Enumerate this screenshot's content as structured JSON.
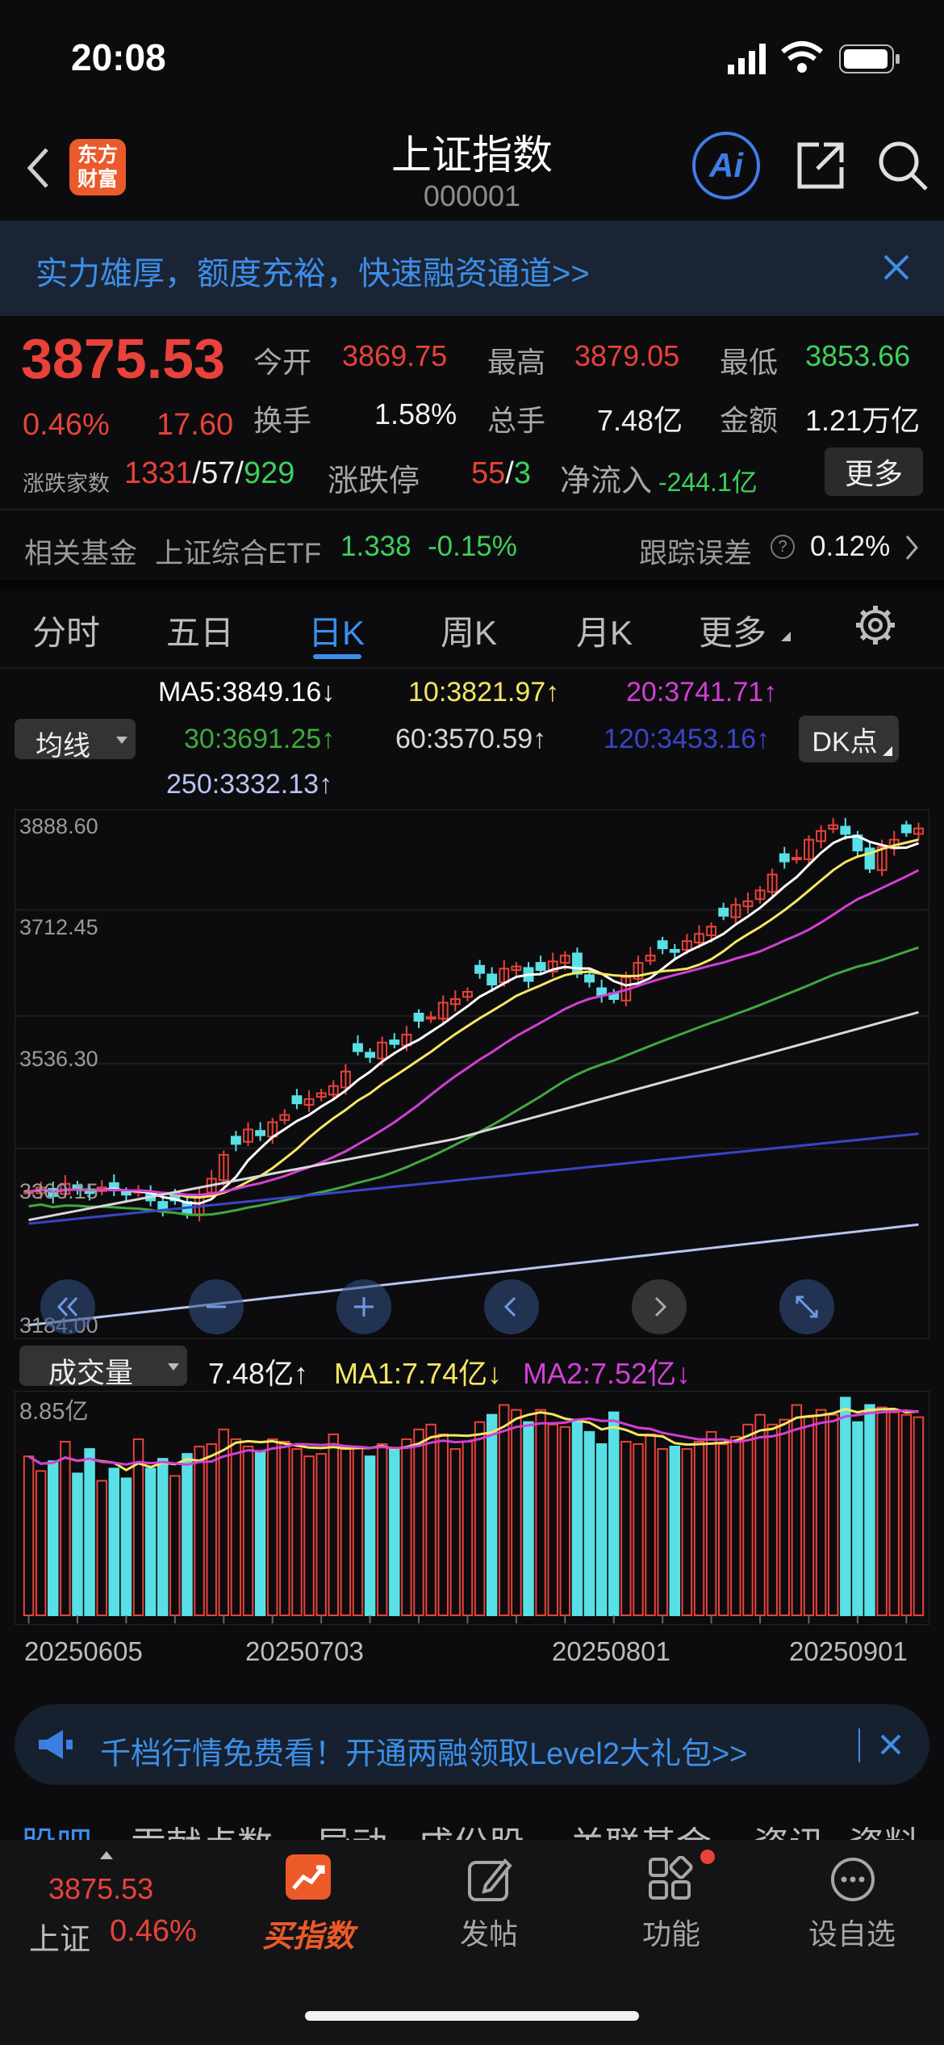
{
  "status_bar": {
    "time": "20:08"
  },
  "header": {
    "title": "上证指数",
    "code": "000001",
    "logo_line1": "东方",
    "logo_line2": "财富",
    "ai_label": "Ai"
  },
  "banner": {
    "text": "实力雄厚，额度充裕，快速融资通道>>"
  },
  "quote": {
    "price": "3875.53",
    "change_pct": "0.46%",
    "change": "17.60",
    "open_label": "今开",
    "open": "3869.75",
    "high_label": "最高",
    "high": "3879.05",
    "low_label": "最低",
    "low": "3853.66",
    "turnover_label": "换手",
    "turnover": "1.58%",
    "volume_label": "总手",
    "volume": "7.48亿",
    "amount_label": "金额",
    "amount": "1.21万亿",
    "breadth_label": "涨跌家数",
    "up_count": "1331",
    "sep1": "/",
    "flat_count": "57",
    "sep2": "/",
    "down_count": "929",
    "limit_label": "涨跌停",
    "limit_up": "55",
    "sep3": "/",
    "limit_down": "3",
    "netflow_label": "净流入",
    "netflow": "-244.1亿",
    "more_button": "更多"
  },
  "fund": {
    "label": "相关基金",
    "name": "上证综合ETF",
    "price": "1.338",
    "change": "-0.15%",
    "track_label": "跟踪误差",
    "track_value": "0.12%",
    "help": "?"
  },
  "tabs": [
    "分时",
    "五日",
    "日K",
    "周K",
    "月K",
    "更多"
  ],
  "active_tab": "日K",
  "ma": {
    "selector": "均线",
    "ma5": "MA5:3849.16↓",
    "ma10": "10:3821.97↑",
    "ma20": "20:3741.71↑",
    "ma30": "30:3691.25↑",
    "ma60": "60:3570.59↑",
    "ma120": "120:3453.16↑",
    "ma250": "250:3332.13↑",
    "dk_button": "DK点",
    "colors": {
      "ma5": "#ffffff",
      "ma10": "#f5e663",
      "ma20": "#d43fd6",
      "ma30": "#3fa83f",
      "ma60": "#d8d8d8",
      "ma120": "#3a44c8",
      "ma250": "#b9c4f2"
    }
  },
  "kline_axis": {
    "y_labels": [
      "3888.60",
      "3712.45",
      "3536.30",
      "3360.15",
      "3184.00"
    ],
    "ylim": [
      3184.0,
      3888.6
    ]
  },
  "volume_panel": {
    "selector": "成交量",
    "vol": "7.48亿↑",
    "ma1": "MA1:7.74亿↓",
    "ma2": "MA2:7.52亿↓",
    "max_label": "8.85亿",
    "x_labels": [
      "20250605",
      "20250703",
      "20250801",
      "20250901"
    ]
  },
  "promo": {
    "text": "千档行情免费看！开通两融领取Level2大礼包>>"
  },
  "bottom_tabs_partial": [
    "股吧",
    "贡献点数",
    "异动",
    "成份股",
    "关联基金",
    "资讯",
    "资料"
  ],
  "bottom_nav": {
    "index_price": "3875.53",
    "index_name": "上证",
    "index_pct": "0.46%",
    "buy": "买指数",
    "post": "发帖",
    "func": "功能",
    "watch": "设自选"
  },
  "chart_data": {
    "type": "candlestick",
    "ylim": [
      3184.0,
      3888.6
    ],
    "close": [
      3374,
      3380,
      3368,
      3385,
      3378,
      3372,
      3380,
      3376,
      3370,
      3375,
      3362,
      3350,
      3362,
      3345,
      3370,
      3392,
      3425,
      3440,
      3460,
      3452,
      3470,
      3480,
      3496,
      3502,
      3510,
      3520,
      3540,
      3568,
      3560,
      3580,
      3578,
      3591,
      3610,
      3615,
      3635,
      3640,
      3650,
      3676,
      3660,
      3682,
      3685,
      3665,
      3680,
      3692,
      3700,
      3675,
      3664,
      3645,
      3640,
      3670,
      3690,
      3700,
      3710,
      3705,
      3720,
      3730,
      3740,
      3755,
      3770,
      3775,
      3790,
      3812,
      3830,
      3835,
      3860,
      3872,
      3880,
      3868,
      3845,
      3820,
      3850,
      3860,
      3870,
      3875.53
    ],
    "volume_yi": [
      6.5,
      5.9,
      6.3,
      7.1,
      5.8,
      6.8,
      5.5,
      6.0,
      5.6,
      7.2,
      6.0,
      6.4,
      5.7,
      6.6,
      6.9,
      7.0,
      7.6,
      7.2,
      6.9,
      6.7,
      7.2,
      7.1,
      6.8,
      6.5,
      6.6,
      7.4,
      6.8,
      6.9,
      6.5,
      7.0,
      6.8,
      7.2,
      7.6,
      7.8,
      7.4,
      6.8,
      7.1,
      7.9,
      8.2,
      8.6,
      8.4,
      7.9,
      8.4,
      7.8,
      7.7,
      8.0,
      7.5,
      7.0,
      8.3,
      7.1,
      7.0,
      7.4,
      6.8,
      6.9,
      6.8,
      7.1,
      7.5,
      7.0,
      7.3,
      7.8,
      8.2,
      7.8,
      8.0,
      8.6,
      8.1,
      8.4,
      8.2,
      8.9,
      7.9,
      8.6,
      8.5,
      8.3,
      8.2,
      8.1
    ]
  }
}
